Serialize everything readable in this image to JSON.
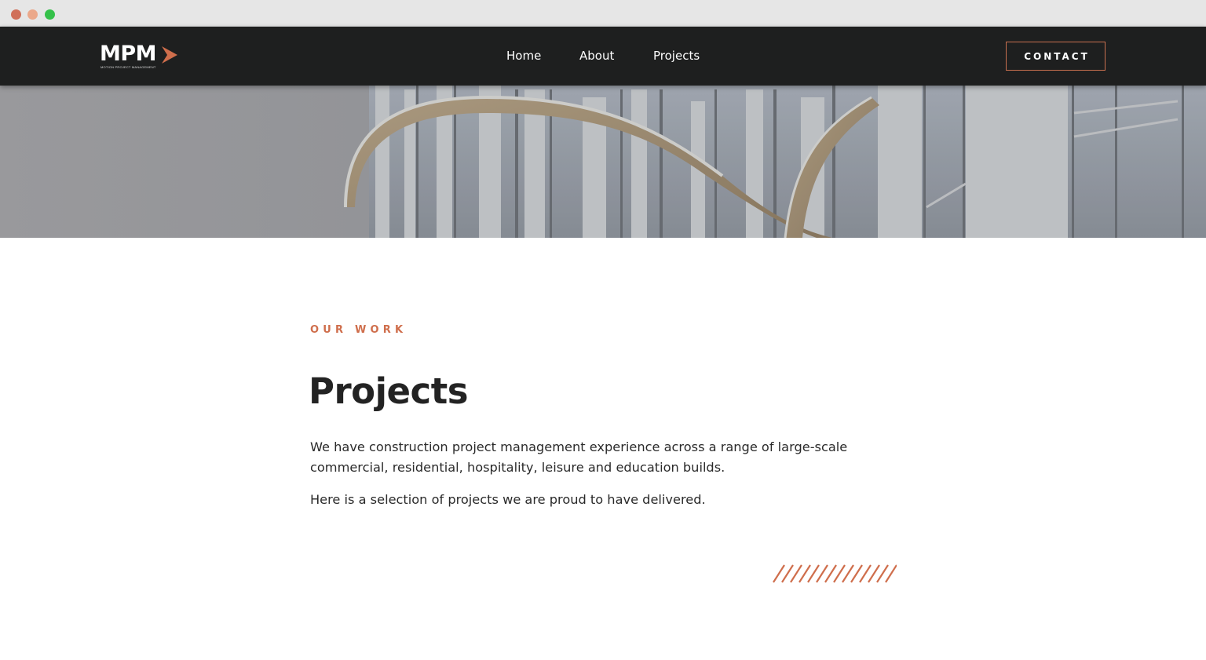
{
  "window": {
    "controls": [
      "close",
      "minimize",
      "maximize"
    ]
  },
  "header": {
    "logo": {
      "text": "MPM",
      "subtitle": "MOTION PROJECT MANAGEMENT",
      "icon": "chevron-right-icon"
    },
    "nav": [
      {
        "label": "Home"
      },
      {
        "label": "About"
      },
      {
        "label": "Projects"
      }
    ],
    "contact_label": "CONTACT"
  },
  "hero": {
    "image": "building-facade-with-curved-balconies"
  },
  "main": {
    "eyebrow": "OUR WORK",
    "title": "Projects",
    "paragraphs": [
      "We have construction project management experience across a range of large-scale commercial, residential, hospitality, leisure and education builds.",
      "Here is a selection of projects we are proud to have delivered."
    ],
    "decoration": "diagonal-hatch"
  },
  "colors": {
    "accent": "#cf6e4c",
    "header_bg": "#1e1f1f",
    "text": "#232323"
  }
}
